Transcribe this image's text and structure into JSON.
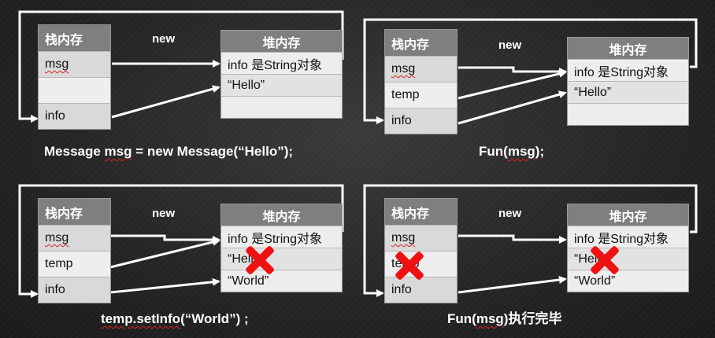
{
  "panels": [
    {
      "stack_title": "栈内存",
      "stack_rows": [
        "msg",
        "",
        "info"
      ],
      "heap_title": "堆内存",
      "heap_rows": [
        "info 是String对象",
        "“Hello”",
        ""
      ],
      "new_label": "new",
      "caption_parts": [
        "Message ",
        "msg",
        " = new Message(“Hello”);"
      ]
    },
    {
      "stack_title": "栈内存",
      "stack_rows": [
        "msg",
        "temp",
        "info"
      ],
      "heap_title": "堆内存",
      "heap_rows": [
        "info 是String对象",
        "“Hello”",
        ""
      ],
      "new_label": "new",
      "caption_parts": [
        "Fun(",
        "msg",
        ");"
      ]
    },
    {
      "stack_title": "栈内存",
      "stack_rows": [
        "msg",
        "temp",
        "info"
      ],
      "heap_title": "堆内存",
      "heap_rows": [
        "info 是String对象",
        "“Hello”",
        "“World”"
      ],
      "new_label": "new",
      "caption_parts": [
        "temp.setInfo",
        "(“World”) ;"
      ]
    },
    {
      "stack_title": "栈内存",
      "stack_rows": [
        "msg",
        "temp",
        "info"
      ],
      "heap_title": "堆内存",
      "heap_rows": [
        "info 是String对象",
        "“Hello”",
        "“World”"
      ],
      "new_label": "new",
      "caption_parts": [
        "Fun(",
        "msg",
        ")执行完毕"
      ]
    }
  ],
  "colors": {
    "wire": "#ffffff",
    "cross": "#ee1111",
    "header": "#7f7f7f"
  }
}
